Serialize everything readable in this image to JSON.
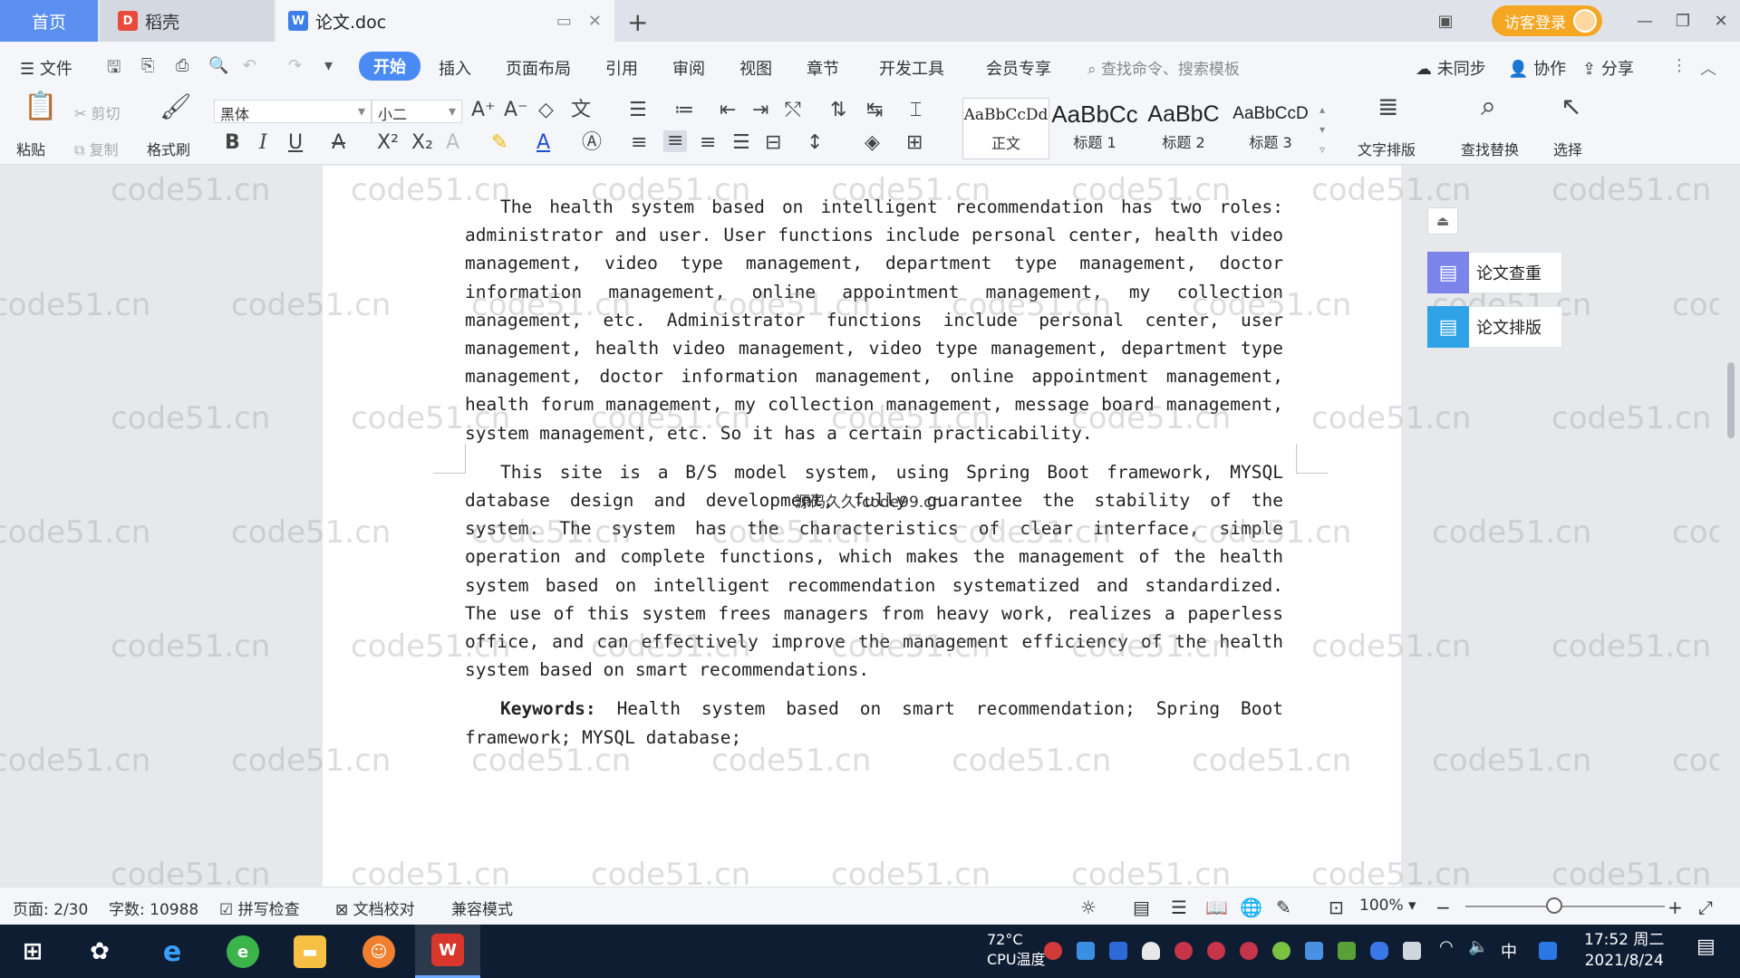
{
  "tabs": {
    "home": "首页",
    "shell": "稻壳",
    "doc": "论文.doc"
  },
  "topbar": {
    "login": "访客登录"
  },
  "menu": {
    "file": "文件",
    "items": [
      "开始",
      "插入",
      "页面布局",
      "引用",
      "审阅",
      "视图",
      "章节",
      "开发工具",
      "会员专享"
    ],
    "search_placeholder": "查找命令、搜索模板",
    "sync": "未同步",
    "collab": "协作",
    "share": "分享"
  },
  "ribbon": {
    "paste": "粘贴",
    "cut": "剪切",
    "copy": "复制",
    "format_painter": "格式刷",
    "font_name": "黑体",
    "font_size": "小二",
    "styles": [
      {
        "preview": "AaBbCcDd",
        "label": "正文"
      },
      {
        "preview": "AaBbCc",
        "label": "标题 1"
      },
      {
        "preview": "AaBbC",
        "label": "标题 2"
      },
      {
        "preview": "AaBbCcD",
        "label": "标题 3"
      }
    ],
    "text_layout": "文字排版",
    "find_replace": "查找替换",
    "select": "选择"
  },
  "document": {
    "para1": "The health system based on intelligent recommendation has two roles: administrator and user. User functions include personal center, health video management, video type management, department type management, doctor information management, online appointment management, my collection management, etc. Administrator functions include personal center, user management, health video management, video type management, department type management, doctor information management, online appointment management, health forum management, my collection management, message board management, system management, etc. So it has a certain practicability.",
    "para2": "This site is a B/S model system, using Spring Boot framework, MYSQL database design and development, fully guarantee the stability of the system. The system has the characteristics of clear interface, simple operation and complete functions, which makes the management of the health system based on intelligent recommendation systematized and standardized. The use of this system frees managers from heavy work, realizes a paperless office, and can effectively improve the management efficiency of the health system based on smart recommendations.",
    "keywords_label": "Keywords:",
    "keywords_text": "Health system based on smart recommendation; Spring Boot framework; MYSQL database;",
    "overlay": "源码久久-code99.cn",
    "watermark": "code51.cn"
  },
  "side_panel": {
    "check": "论文查重",
    "layout": "论文排版"
  },
  "status": {
    "page": "页面: 2/30",
    "words": "字数: 10988",
    "spell": "拼写检查",
    "proof": "文档校对",
    "compat": "兼容模式",
    "zoom": "100%"
  },
  "taskbar": {
    "temp": "72°C",
    "temp_label": "CPU温度",
    "ime": "中",
    "time": "17:52 周二",
    "date": "2021/8/24"
  },
  "colors": {
    "accent": "#4a8af4",
    "home_tab": "#5b8ff0",
    "login": "#f5a623",
    "taskbar": "#0f1d33"
  }
}
